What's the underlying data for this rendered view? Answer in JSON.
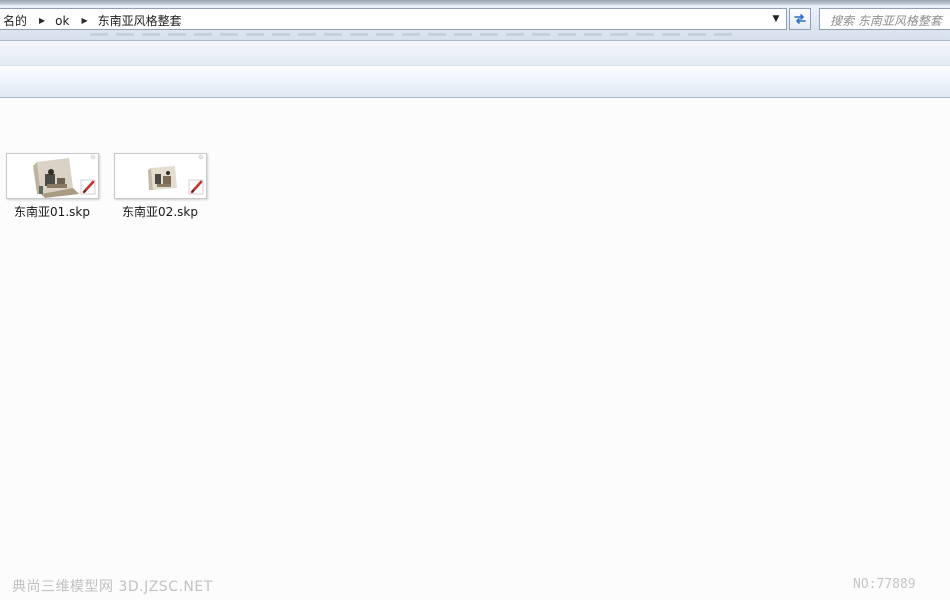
{
  "address_bar": {
    "breadcrumbs": [
      "名的",
      "ok",
      "东南亚风格整套"
    ]
  },
  "search": {
    "placeholder": "搜索 东南亚风格整套"
  },
  "files": [
    {
      "name": "东南亚01.skp",
      "icon": "sketchup-file-icon"
    },
    {
      "name": "东南亚02.skp",
      "icon": "sketchup-file-icon"
    }
  ],
  "watermark": {
    "left": "典尚三维模型网 3D.JZSC.NET",
    "right": "NO:77889"
  },
  "colors": {
    "bar_background": "#d6e0ec",
    "content_background": "#fcfcfc",
    "border": "#8e9fb6"
  }
}
